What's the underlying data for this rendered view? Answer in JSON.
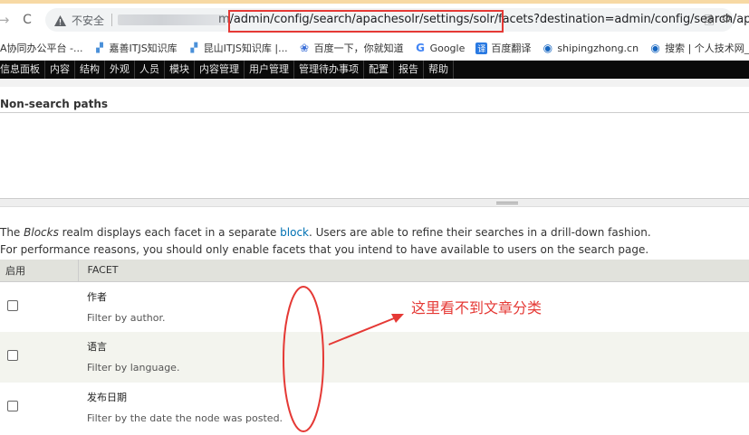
{
  "browser": {
    "security_label": "不安全",
    "url_start": "m",
    "url_path": "/admin/config/search/apachesolr/settings/solr/facets",
    "url_rest": "?destination=admin/config/search/ap..."
  },
  "bookmarks": [
    {
      "label": "A协同办公平台 -...",
      "icon": "doc-icon"
    },
    {
      "label": "嘉善ITJS知识库",
      "icon": "chart-icon"
    },
    {
      "label": "昆山ITJS知识库 |...",
      "icon": "chart-icon"
    },
    {
      "label": "百度一下，你就知道",
      "icon": "paw-icon"
    },
    {
      "label": "Google",
      "icon": "google-icon"
    },
    {
      "label": "百度翻译",
      "icon": "translate-icon"
    },
    {
      "label": "shipingzhong.cn",
      "icon": "globe-icon"
    },
    {
      "label": "搜索 | 个人技术网_...",
      "icon": "globe-icon"
    }
  ],
  "toolbar": [
    "信息面板",
    "内容",
    "结构",
    "外观",
    "人员",
    "模块",
    "内容管理",
    "用户管理",
    "管理待办事项",
    "配置",
    "报告",
    "帮助"
  ],
  "content": {
    "nonsearch_label": "Non-search paths",
    "desc1_pre": "The ",
    "desc1_em": "Blocks",
    "desc1_mid": " realm displays each facet in a separate ",
    "desc1_link": "block",
    "desc1_post": ". Users are able to refine their searches in a drill-down fashion.",
    "desc2": "For performance reasons, you should only enable facets that you intend to have available to users on the search page."
  },
  "table": {
    "headers": [
      "启用",
      "FACET"
    ],
    "rows": [
      {
        "name": "作者",
        "desc": "Filter by author.",
        "enabled": false
      },
      {
        "name": "语言",
        "desc": "Filter by language.",
        "enabled": false
      },
      {
        "name": "发布日期",
        "desc": "Filter by the date the node was posted.",
        "enabled": false
      }
    ]
  },
  "annotation": {
    "text": "这里看不到文章分类",
    "color": "#e53935"
  }
}
